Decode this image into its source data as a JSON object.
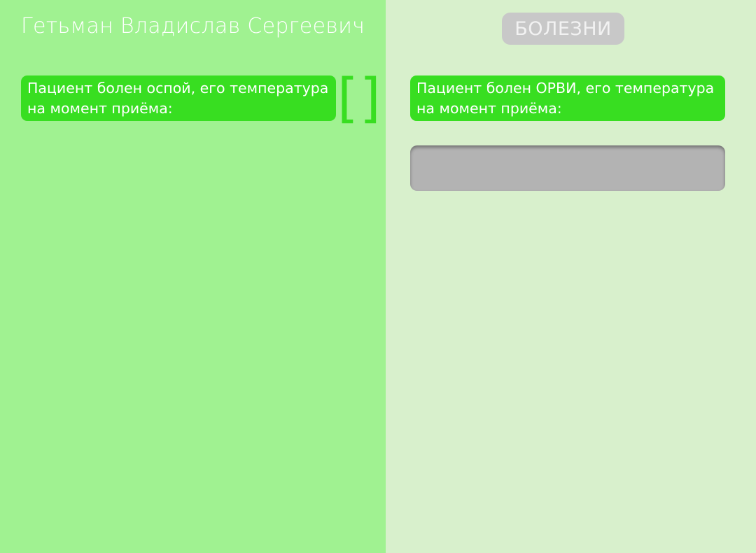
{
  "patient": {
    "name": "Гетьман Владислав Сергеевич"
  },
  "tabs": {
    "diseases_label": "БОЛЕЗНИ"
  },
  "cards": {
    "left_text": "Пациент болен оспой, его температура на момент приёма:",
    "right_text": "Пациент болен ОРВИ, его температура на момент приёма:"
  },
  "brackets": {
    "open": "[",
    "close": "]"
  },
  "temperature_input": {
    "value": "",
    "placeholder": ""
  },
  "colors": {
    "left_background": "#a0f291",
    "right_background": "#d8f0cc",
    "card_green": "#38de21",
    "tab_gray": "#c8c8c8",
    "input_gray": "#b3b3b3"
  }
}
